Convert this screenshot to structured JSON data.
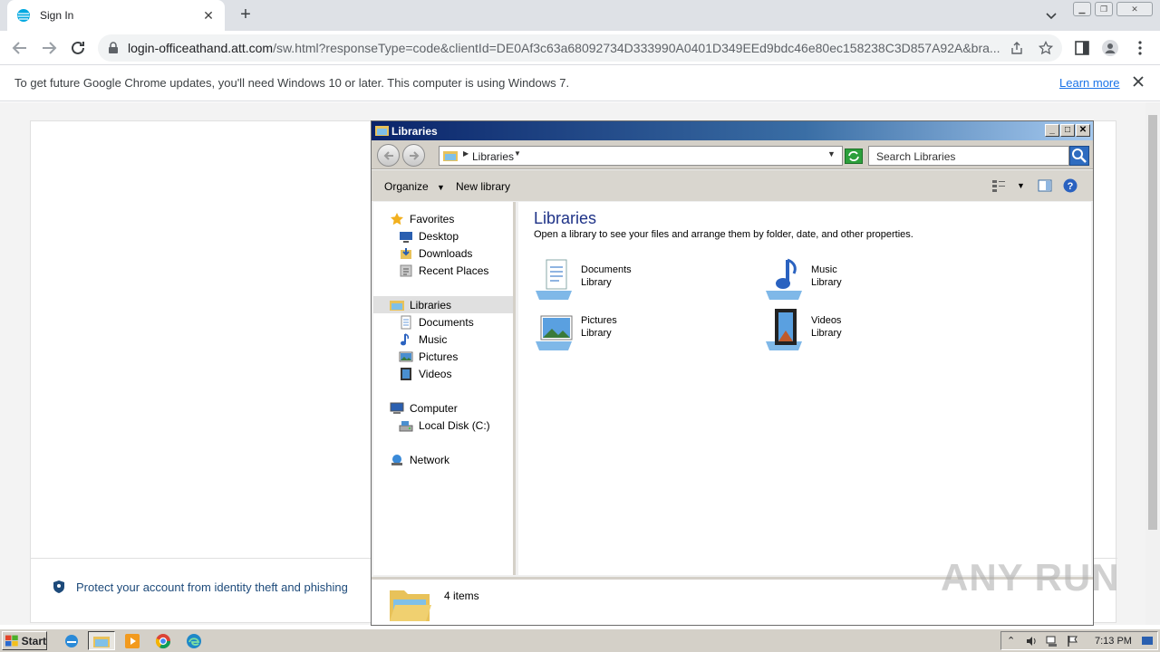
{
  "browser": {
    "tab_title": "Sign In",
    "url_host": "login-officeathand.att.com",
    "url_path": "/sw.html?responseType=code&clientId=DE0Af3c63a68092734D333990A0401D349EEd9bdc46e80ec158238C3D857A92A&bra...",
    "infobar_message": "To get future Google Chrome updates, you'll need Windows 10 or later. This computer is using Windows 7.",
    "infobar_link": "Learn more"
  },
  "page": {
    "protect_text": "Protect your account from identity theft and phishing"
  },
  "explorer": {
    "title": "Libraries",
    "address": "Libraries",
    "search_placeholder": "Search Libraries",
    "organize_label": "Organize",
    "new_library_label": "New library",
    "nav": {
      "favorites": "Favorites",
      "desktop": "Desktop",
      "downloads": "Downloads",
      "recent": "Recent Places",
      "libraries": "Libraries",
      "documents": "Documents",
      "music": "Music",
      "pictures": "Pictures",
      "videos": "Videos",
      "computer": "Computer",
      "local_disk": "Local Disk (C:)",
      "network": "Network"
    },
    "heading": "Libraries",
    "subheading": "Open a library to see your files and arrange them by folder, date, and other properties.",
    "libraries": [
      {
        "name": "Documents",
        "kind": "Library",
        "icon": "documents-library-icon"
      },
      {
        "name": "Music",
        "kind": "Library",
        "icon": "music-library-icon"
      },
      {
        "name": "Pictures",
        "kind": "Library",
        "icon": "pictures-library-icon"
      },
      {
        "name": "Videos",
        "kind": "Library",
        "icon": "videos-library-icon"
      }
    ],
    "status_count": "4 items"
  },
  "taskbar": {
    "start_label": "Start",
    "clock": "7:13 PM"
  },
  "watermark": "ANY RUN"
}
